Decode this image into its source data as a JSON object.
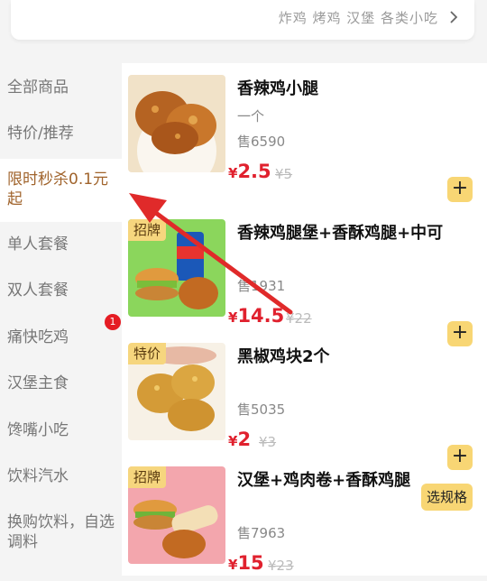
{
  "header": {
    "tags": "炸鸡 烤鸡 汉堡 各类小吃"
  },
  "sidebar": {
    "categories": [
      "全部商品",
      "特价/推荐",
      "限时秒杀0.1元起",
      "单人套餐",
      "双人套餐",
      "痛快吃鸡",
      "汉堡主食",
      "馋嘴小吃",
      "饮料汽水",
      "换购饮料，自选调料"
    ],
    "active_index": 2,
    "badge_count": "1"
  },
  "products": [
    {
      "title": "香辣鸡小腿",
      "subtitle": "一个",
      "sales": "售6590",
      "currency": "¥",
      "price": "2.5",
      "original_price": "¥5",
      "tag": "",
      "action": "+"
    },
    {
      "title": "香辣鸡腿堡+香酥鸡腿+中可",
      "subtitle": "",
      "sales": "售1931",
      "currency": "¥",
      "price": "14.5",
      "original_price": "¥22",
      "tag": "招牌",
      "action": "+"
    },
    {
      "title": "黑椒鸡块2个",
      "subtitle": "",
      "sales": "售5035",
      "currency": "¥",
      "price": "2",
      "original_price": "¥3",
      "tag": "特价",
      "action": "+"
    },
    {
      "title": "汉堡+鸡肉卷+香酥鸡腿",
      "subtitle": "",
      "sales": "售7963",
      "currency": "¥",
      "price": "15",
      "original_price": "¥23",
      "tag": "招牌",
      "action": "选规格"
    }
  ],
  "colors": {
    "accent": "#e0212e",
    "button": "#f8d674",
    "active_category": "#a0632b",
    "annotation_arrow": "#e02a2a"
  }
}
